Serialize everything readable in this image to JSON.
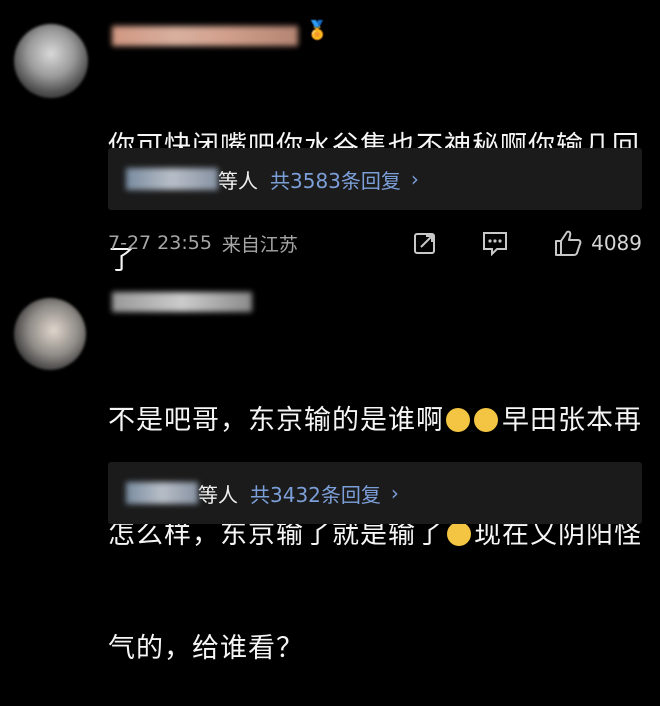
{
  "comments": [
    {
      "text": "你可快闭嘴吧你水谷隼也不神秘啊你输几回了",
      "line1": "你可快闭嘴吧你水谷隼也不神秘啊你输几回",
      "line2": "了",
      "replies": {
        "who": "等人",
        "count": "共3583条回复",
        "arrow": "›"
      },
      "meta": {
        "time": "7-27 23:55",
        "location": "来自江苏",
        "likes": "4089"
      }
    },
    {
      "line1_a": "不是吧哥，东京输的是谁啊",
      "line1_b": "早田张本再",
      "line2_a": "怎么样，东京输了就是输了",
      "line2_b": "现在又阴阳怪",
      "line3": "气的，给谁看？",
      "replies": {
        "who": "等人",
        "count": "共3432条回复",
        "arrow": "›"
      }
    }
  ],
  "colors": {
    "background": "#000000",
    "reply_bg": "#1b1b1b",
    "link": "#7c9fd9"
  },
  "icons": [
    "share-icon",
    "comment-icon",
    "like-icon",
    "laughing-emoji-icon",
    "smile-emoji-icon",
    "arrow-right-icon"
  ]
}
